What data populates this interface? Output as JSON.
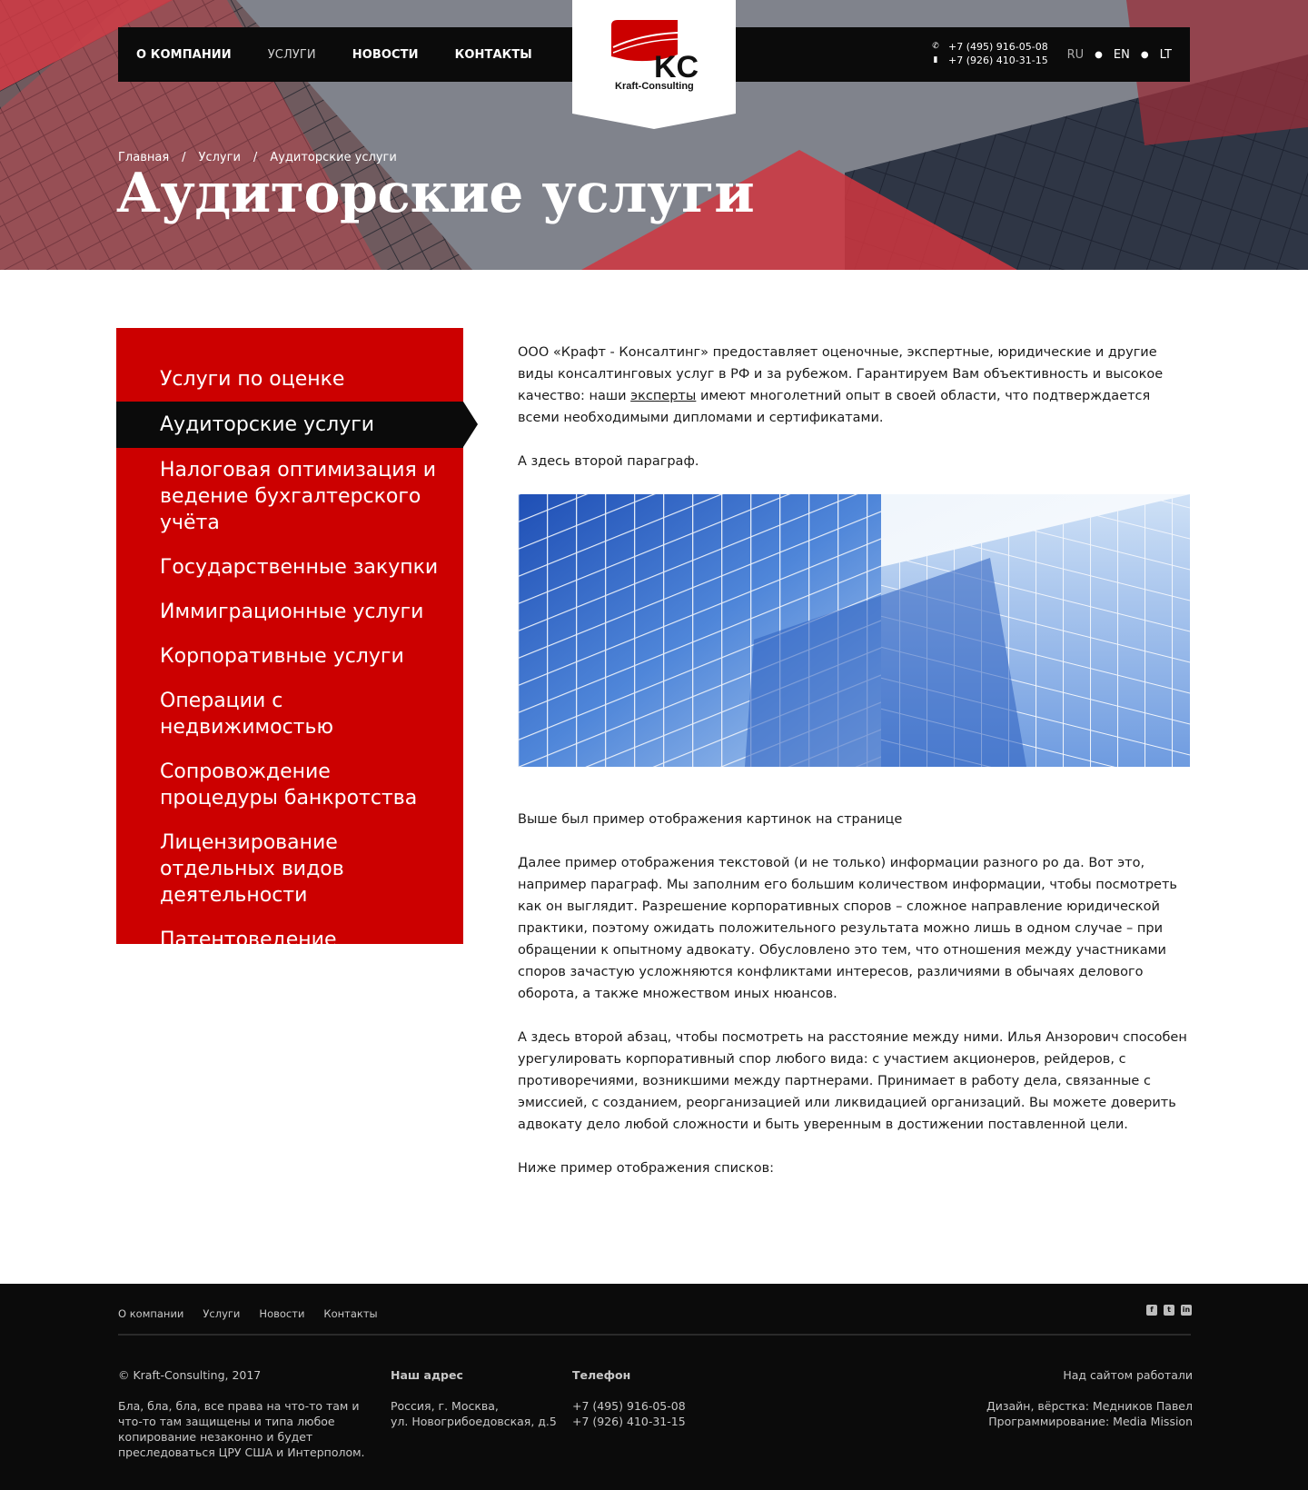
{
  "header": {
    "nav": [
      {
        "label": "О КОМПАНИИ",
        "active": false
      },
      {
        "label": "УСЛУГИ",
        "active": true
      },
      {
        "label": "НОВОСТИ",
        "active": false
      },
      {
        "label": "КОНТАКТЫ",
        "active": false
      }
    ],
    "logo": {
      "initials": "KC",
      "name": "Kraft-Consulting"
    },
    "phones": [
      "+7 (495) 916-05-08",
      "+7 (926) 410-31-15"
    ],
    "phone_icons": [
      "phone-icon",
      "mobile-icon"
    ],
    "languages": [
      {
        "label": "RU",
        "active": true
      },
      {
        "label": "EN",
        "active": false
      },
      {
        "label": "LT",
        "active": false
      }
    ]
  },
  "breadcrumb": {
    "items": [
      "Главная",
      "Услуги",
      "Аудиторские услуги"
    ],
    "separator": "/"
  },
  "page_title": "Аудиторские услуги",
  "sidebar": {
    "items": [
      {
        "label": "Услуги по оценке",
        "active": false
      },
      {
        "label": "Аудиторские услуги",
        "active": true
      },
      {
        "label": "Налоговая оптимизация и ведение бухгалтерского учёта",
        "active": false
      },
      {
        "label": "Государственные закупки",
        "active": false
      },
      {
        "label": "Иммиграционные услуги",
        "active": false
      },
      {
        "label": "Корпоративные услуги",
        "active": false
      },
      {
        "label": "Операции с недвижимостью",
        "active": false
      },
      {
        "label": "Сопровождение процедуры банкротства",
        "active": false
      },
      {
        "label": "Лицензирование отдельных видов деятельности",
        "active": false
      },
      {
        "label": "Патентоведение",
        "active": false
      }
    ]
  },
  "content": {
    "intro_before_link": "ООО «Крафт - Консалтинг» предоставляет оценочные, экспертные, юридические и другие виды консалтинговых услуг в РФ и за рубежом. Гарантируем Вам объективность и высокое качество: наши ",
    "intro_link": "эксперты",
    "intro_after_link": " имеют многолетний опыт в своей области, что подтверждается всеми необходимыми дипломами и сертификатами.",
    "p2": "А здесь второй параграф.",
    "after_image": "Выше был пример отображения картинок на странице",
    "p3": "Далее пример отображения текстовой (и не только) информации разного ро да. Вот это, например параграф. Мы заполним его большим количеством информации, чтобы посмотреть как он выглядит. Разрешение корпоративных споров – сложное направление юридической практики, поэтому ожидать положительного результата можно лишь в одном случае – при обращении к опытному адвокату. Обусловлено это тем, что отношения между участниками споров зачастую усложняются конфликтами интересов, различиями в обычаях делового оборота, а также множеством иных нюансов.",
    "p4": "А здесь второй абзац, чтобы посмотреть на расстояние между ними. Илья Анзорович способен урегулировать корпоративный спор любого вида: с участием акционеров, рейдеров, с противоречиями, возникшими между партнерами. Принимает в работу дела, связанные с эмиссией, с созданием, реорганизацией или ликвидацией организаций. Вы можете доверить адвокату дело любой сложности и быть уверенным в достижении поставленной цели.",
    "p5": "Ниже пример отображения списков:"
  },
  "footer": {
    "nav": [
      "О компании",
      "Услуги",
      "Новости",
      "Контакты"
    ],
    "social_icons": [
      "facebook-icon",
      "twitter-icon",
      "linkedin-icon"
    ],
    "copyright": "© Kraft-Consulting, 2017",
    "disclaimer": "Бла, бла, бла, все права на что-то там и что-то там защищены и типа любое копирование незаконно и будет преследоваться ЦРУ США и Интерполом.",
    "address_heading": "Наш адрес",
    "address_line1": "Россия, г. Москва,",
    "address_line2": "ул. Новогрибоедовская, д.5",
    "phone_heading": "Телефон",
    "phone1": "+7 (495) 916-05-08",
    "phone2": "+7 (926) 410-31-15",
    "credits_heading": "Над сайтом работали",
    "credits_design": "Дизайн, вёрстка: Медников Павел",
    "credits_dev": "Программирование: Media Mission"
  },
  "colors": {
    "brand_red": "#cc0000",
    "black": "#0b0b0b",
    "hero_gray": "#7d8089"
  }
}
